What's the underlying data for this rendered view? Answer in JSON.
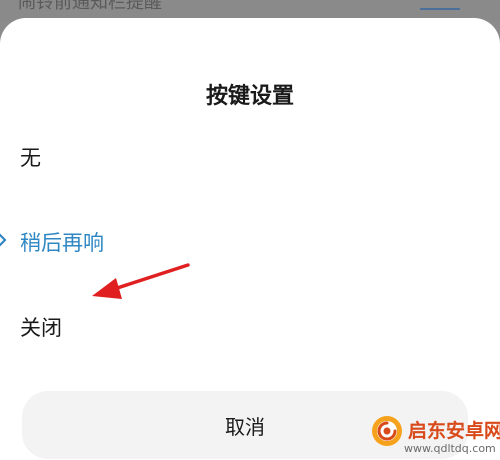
{
  "background": {
    "partial_text": "闹铃前通知栏提醒"
  },
  "dialog": {
    "title": "按键设置",
    "options": [
      {
        "label": "无",
        "selected": false
      },
      {
        "label": "稍后再响",
        "selected": true
      },
      {
        "label": "关闭",
        "selected": false
      }
    ],
    "cancel_label": "取消",
    "accent_color": "#2f87c4",
    "annotation_arrow_color": "#e02020"
  },
  "watermark": {
    "title": "启东安卓网",
    "url": "www.qdltdq.com"
  }
}
